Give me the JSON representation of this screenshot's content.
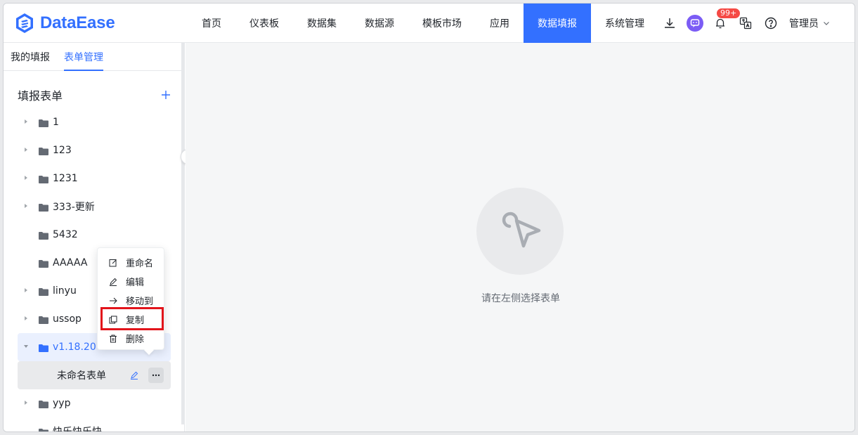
{
  "app": {
    "logo_text": "DataEase",
    "brand_color": "#3370ff"
  },
  "nav": {
    "items": [
      {
        "label": "首页"
      },
      {
        "label": "仪表板"
      },
      {
        "label": "数据集"
      },
      {
        "label": "数据源"
      },
      {
        "label": "模板市场"
      },
      {
        "label": "应用"
      },
      {
        "label": "数据填报",
        "active": true
      },
      {
        "label": "系统管理"
      }
    ],
    "badge_count": "99+",
    "user_name": "管理员",
    "icons": [
      "download-icon",
      "chat-icon",
      "bell-icon",
      "translate-icon",
      "help-icon",
      "chevron-down-icon"
    ]
  },
  "sidebar": {
    "tabs": [
      {
        "label": "我的填报"
      },
      {
        "label": "表单管理",
        "active": true
      }
    ],
    "section_title": "填报表单",
    "add_icon": "plus-icon",
    "tree": [
      {
        "label": "1",
        "has_children": true
      },
      {
        "label": "123",
        "has_children": true
      },
      {
        "label": "1231",
        "has_children": true
      },
      {
        "label": "333-更新",
        "has_children": true
      },
      {
        "label": "5432",
        "has_children": false
      },
      {
        "label": "AAAAA",
        "has_children": false
      },
      {
        "label": "linyu",
        "has_children": true
      },
      {
        "label": "ussop",
        "has_children": true
      },
      {
        "label": "v1.18.20",
        "has_children": true,
        "expanded": true
      },
      {
        "label": "未命名表单",
        "child": true
      },
      {
        "label": "yyp",
        "has_children": true
      },
      {
        "label": "快乐快乐快...",
        "has_children": false
      }
    ]
  },
  "context_menu": {
    "items": [
      {
        "label": "重命名",
        "icon": "rename-icon"
      },
      {
        "label": "编辑",
        "icon": "edit-icon"
      },
      {
        "label": "移动到",
        "icon": "arrow-right-icon"
      },
      {
        "label": "复制",
        "icon": "copy-icon",
        "highlighted": true
      },
      {
        "label": "删除",
        "icon": "trash-icon"
      }
    ],
    "highlight_color": "#e2141b"
  },
  "main": {
    "empty_text": "请在左侧选择表单",
    "empty_icon": "pointer-arrow-icon"
  }
}
